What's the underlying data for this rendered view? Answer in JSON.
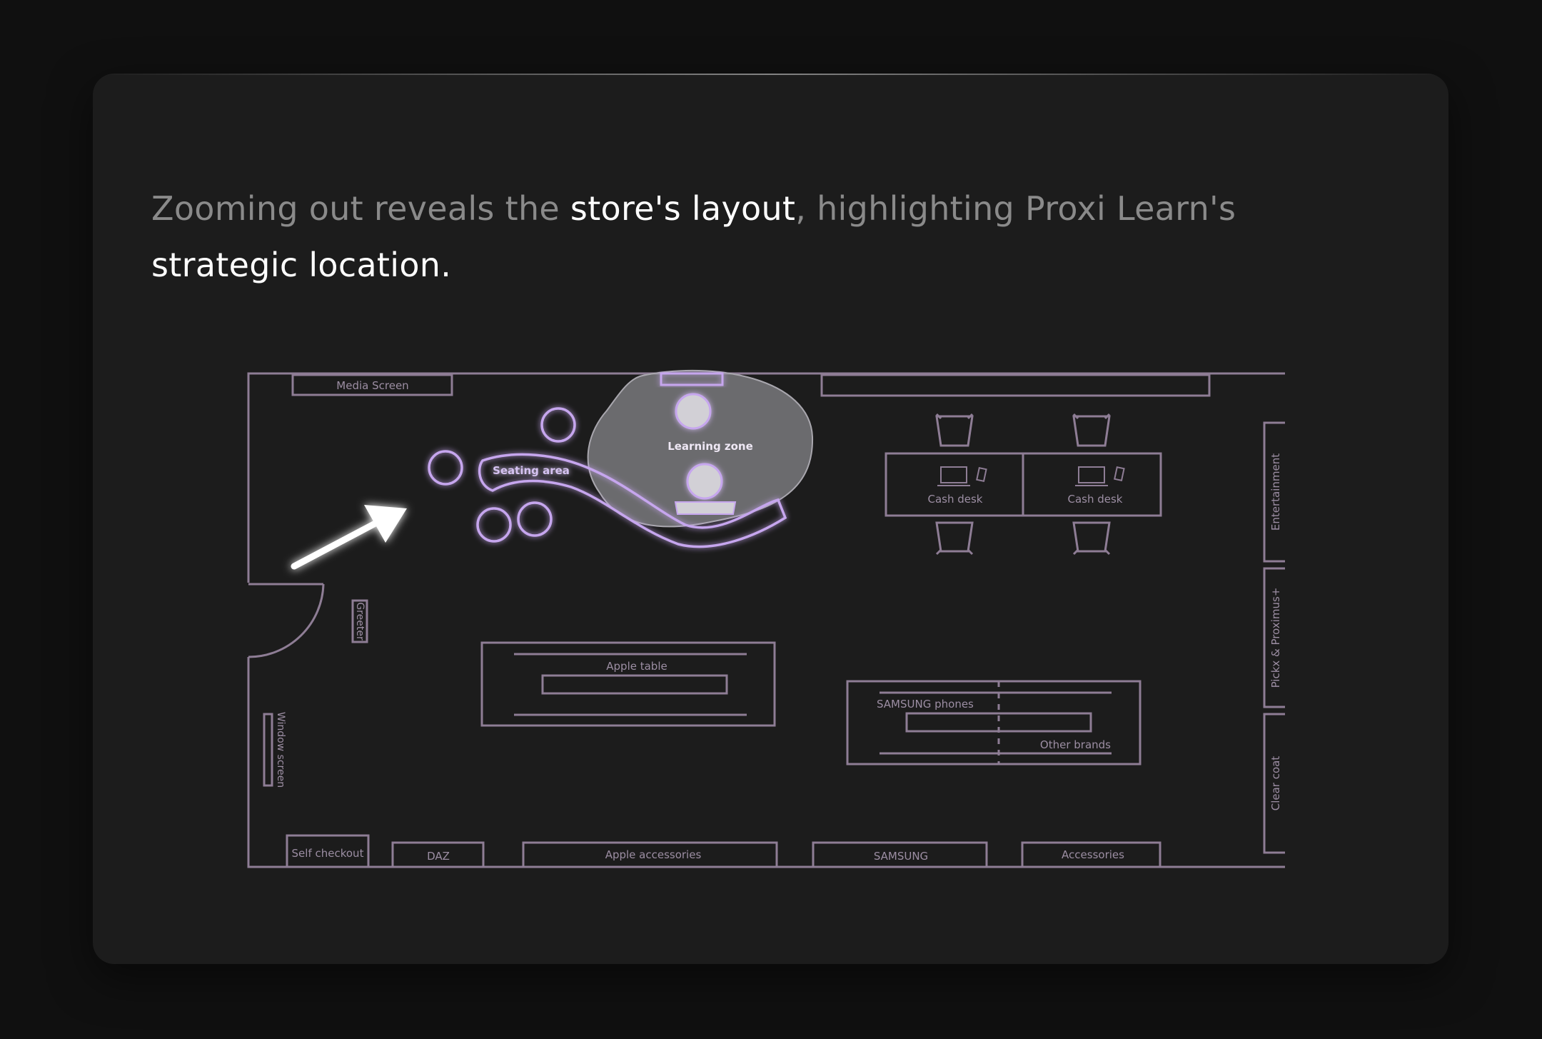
{
  "headline": {
    "part1": "Zooming out reveals the ",
    "highlight1": "store's layout",
    "part2": ", highlighting Proxi Learn's ",
    "highlight2": "strategic location."
  },
  "floor_plan": {
    "media_screen": "Media Screen",
    "learning_zone": "Learning zone",
    "seating_area": "Seating area",
    "cash_desk_1": "Cash desk",
    "cash_desk_2": "Cash desk",
    "entertainment": "Entertainment",
    "pickx_proximus": "Pickx & Proximus+",
    "clear_coat": "Clear coat",
    "greeter": "Greeter",
    "window_screen": "Window screen",
    "apple_table": "Apple table",
    "samsung_phones": "SAMSUNG phones",
    "other_brands": "Other brands",
    "self_checkout": "Self checkout",
    "daz": "DAZ",
    "apple_accessories": "Apple accessories",
    "samsung": "SAMSUNG",
    "accessories": "Accessories"
  },
  "colors": {
    "background": "#101010",
    "card": "#1c1c1c",
    "outline": "#8e7d95",
    "accent": "#c6a6ee",
    "text_muted": "#8a8a8a",
    "text_highlight": "#ffffff"
  },
  "icons": [
    "arrow-icon",
    "laptop-icon",
    "phone-icon",
    "chair-icon"
  ]
}
